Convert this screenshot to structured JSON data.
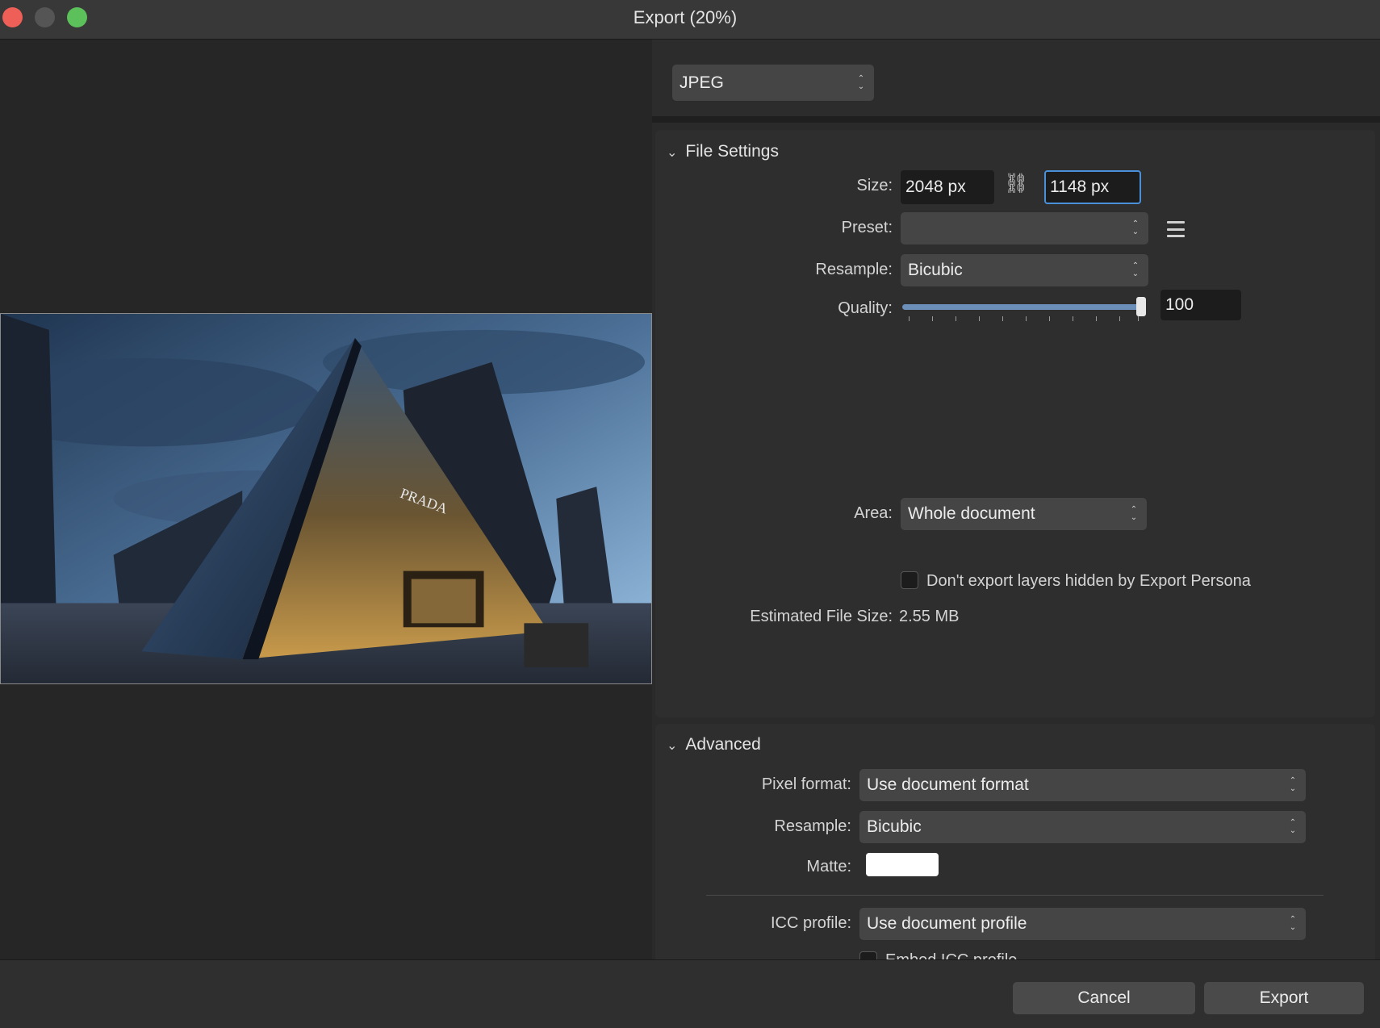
{
  "window": {
    "title": "Export (20%)"
  },
  "format": {
    "selected": "JPEG"
  },
  "file_settings": {
    "header": "File Settings",
    "size_label": "Size:",
    "width": "2048 px",
    "height": "1148 px",
    "preset_label": "Preset:",
    "preset_value": "",
    "resample_label": "Resample:",
    "resample_value": "Bicubic",
    "quality_label": "Quality:",
    "quality_value": "100",
    "quality_level": 1.0,
    "area_label": "Area:",
    "area_value": "Whole document",
    "hidden_layers_label": "Don't export layers hidden by Export Persona",
    "hidden_layers_checked": false,
    "est_size_label": "Estimated File Size:",
    "est_size_value": "2.55 MB"
  },
  "advanced": {
    "header": "Advanced",
    "pixel_format_label": "Pixel format:",
    "pixel_format_value": "Use document format",
    "resample_label": "Resample:",
    "resample_value": "Bicubic",
    "matte_label": "Matte:",
    "matte_color": "#ffffff",
    "icc_label": "ICC profile:",
    "icc_value": "Use document profile",
    "embed_icc_label": "Embed ICC profile"
  },
  "footer": {
    "cancel_label": "Cancel",
    "export_label": "Export"
  },
  "icons": {
    "close": "close-button",
    "minimize": "minimize-button",
    "zoom": "zoom-button",
    "link": "link-icon",
    "preset_menu": "hamburger-menu-icon",
    "disclosure": "chevron-down-icon",
    "stepper": "up-down-stepper-icon"
  }
}
